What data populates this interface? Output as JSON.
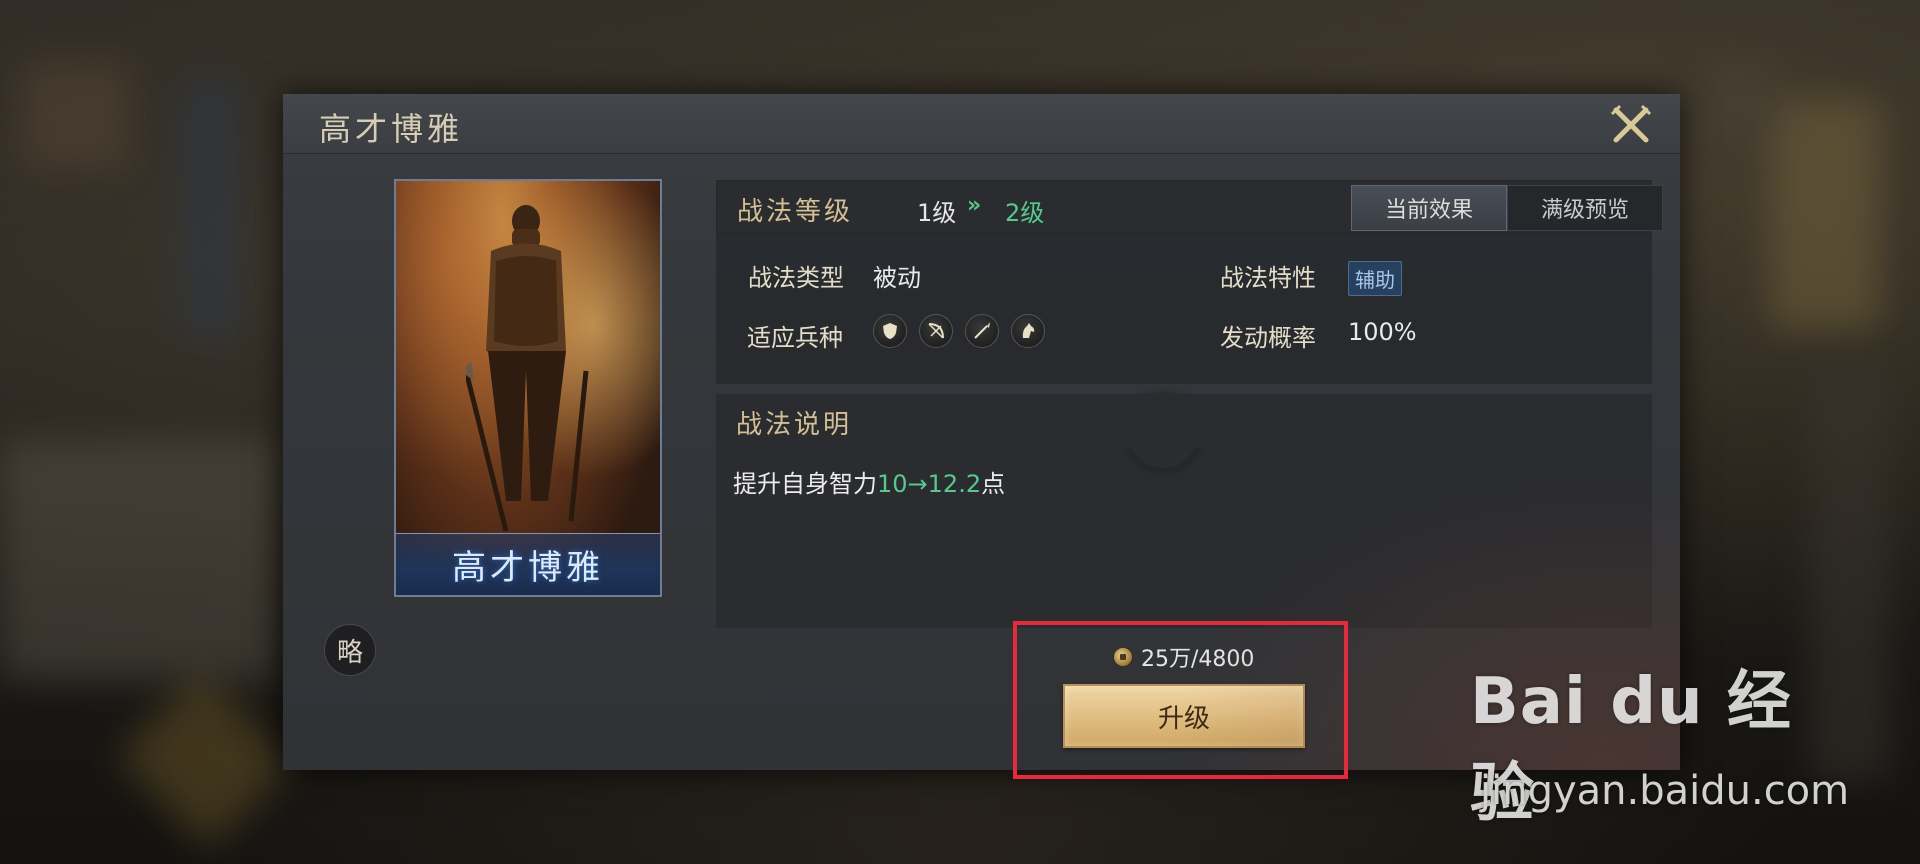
{
  "dialog": {
    "title": "高才博雅",
    "card_name": "高才博雅",
    "strategy_badge": "略"
  },
  "level": {
    "label": "战法等级",
    "from": "1级",
    "arrow": "»",
    "to": "2级"
  },
  "tabs": {
    "current_effect": "当前效果",
    "max_preview": "满级预览"
  },
  "attributes": {
    "type_label": "战法类型",
    "type_value": "被动",
    "trait_label": "战法特性",
    "trait_value": "辅助",
    "units_label": "适应兵种",
    "units": [
      "shield-icon",
      "bow-icon",
      "spear-icon",
      "horse-icon"
    ],
    "rate_label": "发动概率",
    "rate_value": "100%"
  },
  "description": {
    "title": "战法说明",
    "prefix": "提升自身智力",
    "from_value": "10",
    "arrow": "→",
    "to_value": "12.2",
    "suffix": "点"
  },
  "cost": {
    "text": "25万/4800"
  },
  "upgrade_button": {
    "label": "升级"
  },
  "watermark": {
    "logo_text": "Bai du 经验",
    "url": "jingyan.baidu.com"
  },
  "colors": {
    "green": "#59c98b",
    "gold": "#d3bf93",
    "highlight": "#e8283c"
  }
}
